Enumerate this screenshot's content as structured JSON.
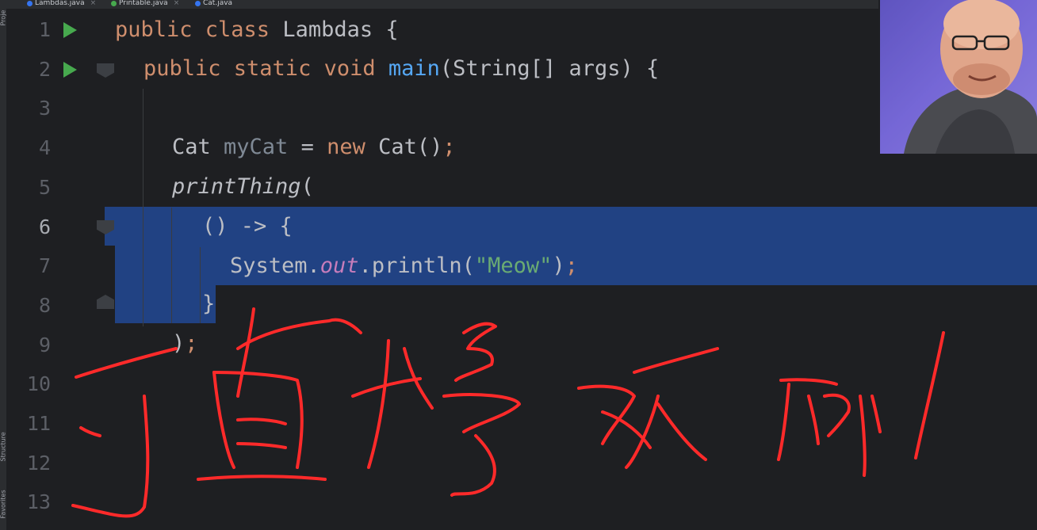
{
  "tabs": [
    {
      "label": "Lambdas.java",
      "color": "#3574f0"
    },
    {
      "label": "Printable.java",
      "color": "#47a94e"
    },
    {
      "label": "Cat.java",
      "color": "#3574f0"
    }
  ],
  "side_tools": {
    "project": "Proje",
    "structure": "Structure",
    "favorites": "Favorites"
  },
  "line_numbers": [
    "1",
    "2",
    "3",
    "4",
    "5",
    "6",
    "7",
    "8",
    "9",
    "10",
    "11",
    "12",
    "13"
  ],
  "code": {
    "line1": {
      "kw": "public class ",
      "name": "Lambdas",
      "rest": " {"
    },
    "line2": {
      "kw": "public static void ",
      "fn": "main",
      "rest": "(String[] args) {"
    },
    "line4": {
      "type": "Cat ",
      "var": "myCat",
      "op": " = ",
      "kw": "new ",
      "call": "Cat()",
      "semi": ";"
    },
    "line5": {
      "fn": "printThing",
      "rest": "("
    },
    "line6": {
      "text": "() -> {"
    },
    "line7": {
      "obj": "System.",
      "field": "out",
      "call": ".println(",
      "str": "\"Meow\"",
      "close": ")",
      "semi": ";"
    },
    "line8": {
      "text": "}"
    },
    "line9": {
      "text": ")",
      "semi": ";"
    }
  },
  "webcam": {
    "label": "presenter-video"
  },
  "annotation": {
    "handwriting": "可直接级例",
    "color": "#ff2a2a"
  }
}
